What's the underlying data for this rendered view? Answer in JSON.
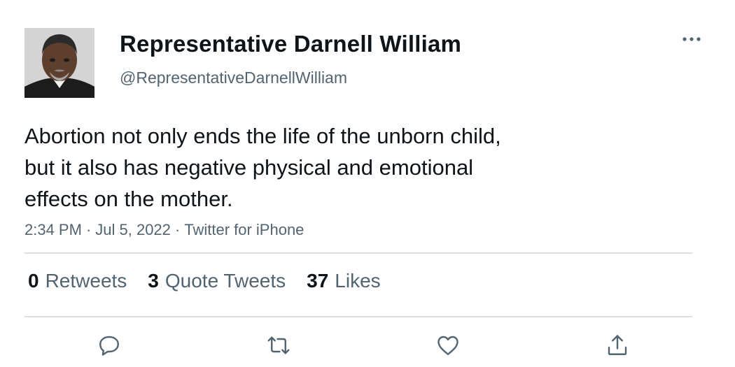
{
  "user": {
    "display_name": "Representative Darnell William",
    "handle": "@RepresentativeDarnellWilliam"
  },
  "tweet": {
    "text_lines": [
      "Abortion not only ends the life of the unborn child,",
      "but it also has negative physical and emotional",
      "effects on the mother."
    ],
    "time": "2:34 PM",
    "date": "Jul 5, 2022",
    "source": "Twitter for iPhone",
    "separator": "·"
  },
  "stats": {
    "retweets": {
      "count": "0",
      "label": "Retweets"
    },
    "quote_tweets": {
      "count": "3",
      "label": "Quote Tweets"
    },
    "likes": {
      "count": "37",
      "label": "Likes"
    }
  },
  "actions": {
    "reply_icon": "reply-icon",
    "retweet_icon": "retweet-icon",
    "like_icon": "heart-icon",
    "share_icon": "share-icon",
    "more_icon": "more-options-icon"
  },
  "colors": {
    "text_primary": "#0f1419",
    "text_secondary": "#536471",
    "icon": "#536471",
    "divider": "#dcdfe2"
  }
}
